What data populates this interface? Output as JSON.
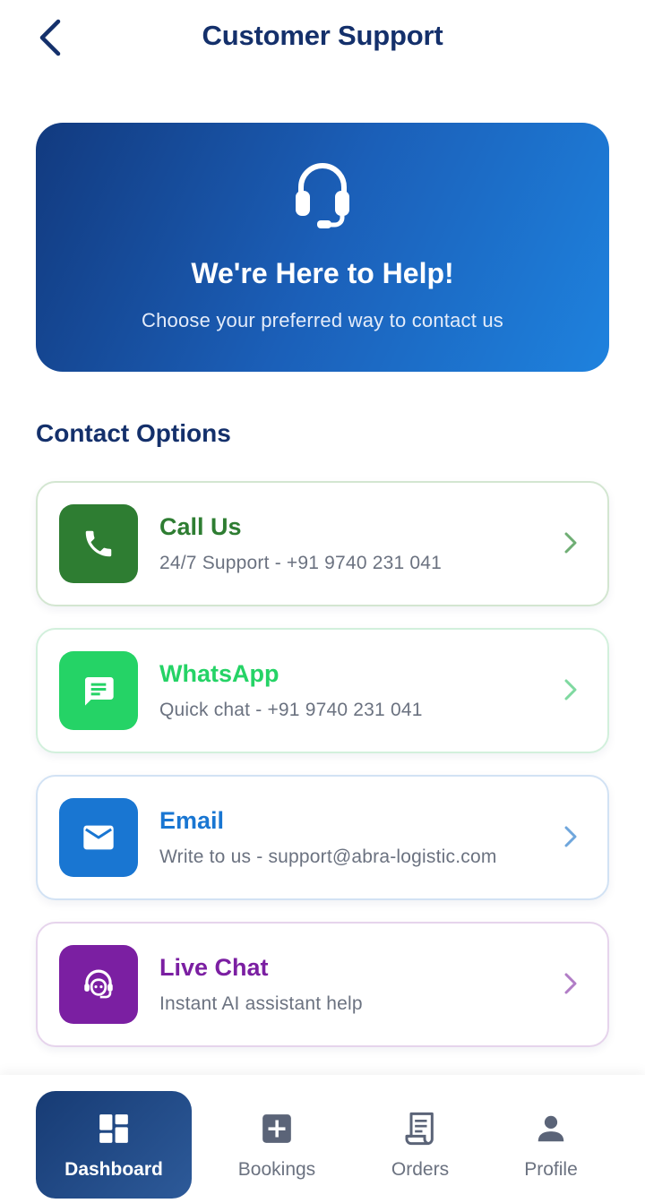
{
  "header": {
    "title": "Customer Support",
    "back_icon": "chevron-left-icon"
  },
  "hero": {
    "icon": "headset-icon",
    "title": "We're Here to Help!",
    "subtitle": "Choose your preferred way to contact us"
  },
  "section": {
    "title": "Contact Options"
  },
  "contact_options": [
    {
      "title": "Call Us",
      "subtitle": "24/7 Support - +91 9740 231 041",
      "icon": "phone-icon",
      "accent": "#2e7d32"
    },
    {
      "title": "WhatsApp",
      "subtitle": "Quick chat - +91 9740 231 041",
      "icon": "chat-message-icon",
      "accent": "#25d366"
    },
    {
      "title": "Email",
      "subtitle": "Write to us - support@abra-logistic.com",
      "icon": "mail-icon",
      "accent": "#1976d2"
    },
    {
      "title": "Live Chat",
      "subtitle": "Instant AI assistant help",
      "icon": "support-agent-icon",
      "accent": "#7b1fa2"
    }
  ],
  "bottom_nav": {
    "items": [
      {
        "label": "Dashboard",
        "icon": "dashboard-icon",
        "active": true
      },
      {
        "label": "Bookings",
        "icon": "add-box-icon",
        "active": false
      },
      {
        "label": "Orders",
        "icon": "receipt-icon",
        "active": false
      },
      {
        "label": "Profile",
        "icon": "person-icon",
        "active": false
      }
    ]
  },
  "colors": {
    "primary": "#14306b",
    "hero_gradient_start": "#123a7f",
    "hero_gradient_end": "#1e82de",
    "muted_text": "#6b7280"
  }
}
